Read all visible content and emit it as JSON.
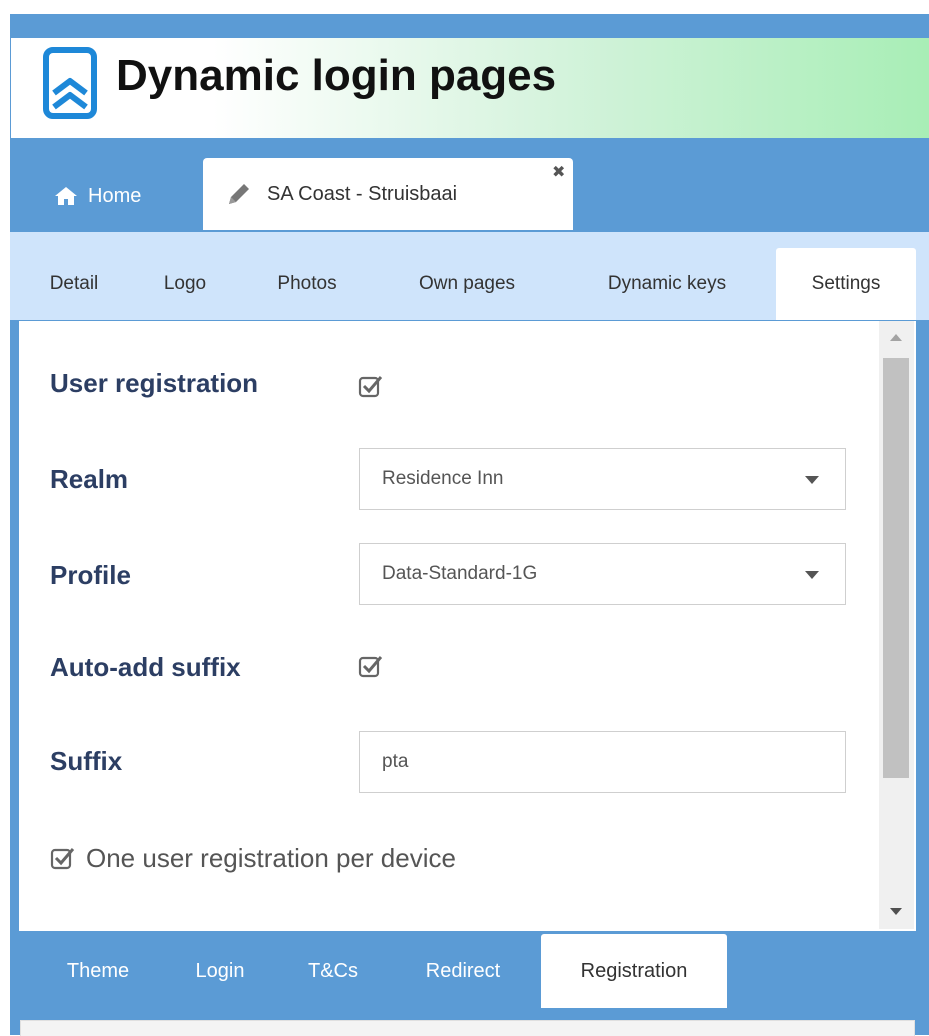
{
  "app": {
    "title": "Dynamic login pages"
  },
  "nav": {
    "home_label": "Home",
    "open_tab_label": "SA Coast - Struisbaai",
    "close_symbol": "✖"
  },
  "subtabs": [
    "Detail",
    "Logo",
    "Photos",
    "Own pages",
    "Dynamic keys",
    "Settings"
  ],
  "subtabs_active": "Settings",
  "form": {
    "user_registration": {
      "label": "User registration",
      "checked": true
    },
    "realm": {
      "label": "Realm",
      "value": "Residence Inn"
    },
    "profile": {
      "label": "Profile",
      "value": "Data-Standard-1G"
    },
    "auto_add_suffix": {
      "label": "Auto-add suffix",
      "checked": true
    },
    "suffix": {
      "label": "Suffix",
      "value": "pta"
    },
    "one_per_device": {
      "label": "One user registration per device",
      "checked": true
    }
  },
  "bottom_tabs": [
    "Theme",
    "Login",
    "T&Cs",
    "Redirect",
    "Registration"
  ],
  "bottom_tabs_active": "Registration",
  "colors": {
    "nav_blue": "#5b9bd5",
    "subtab_bg": "#cfe4fb",
    "label_navy": "#2c3e63",
    "logo_blue": "#1e88d8"
  },
  "icons": {
    "logo": "bookmark-logo-icon",
    "home": "home-icon",
    "edit": "pencil-icon",
    "close": "close-icon",
    "checkbox": "checked-box-icon",
    "dropdown": "caret-down-icon"
  }
}
